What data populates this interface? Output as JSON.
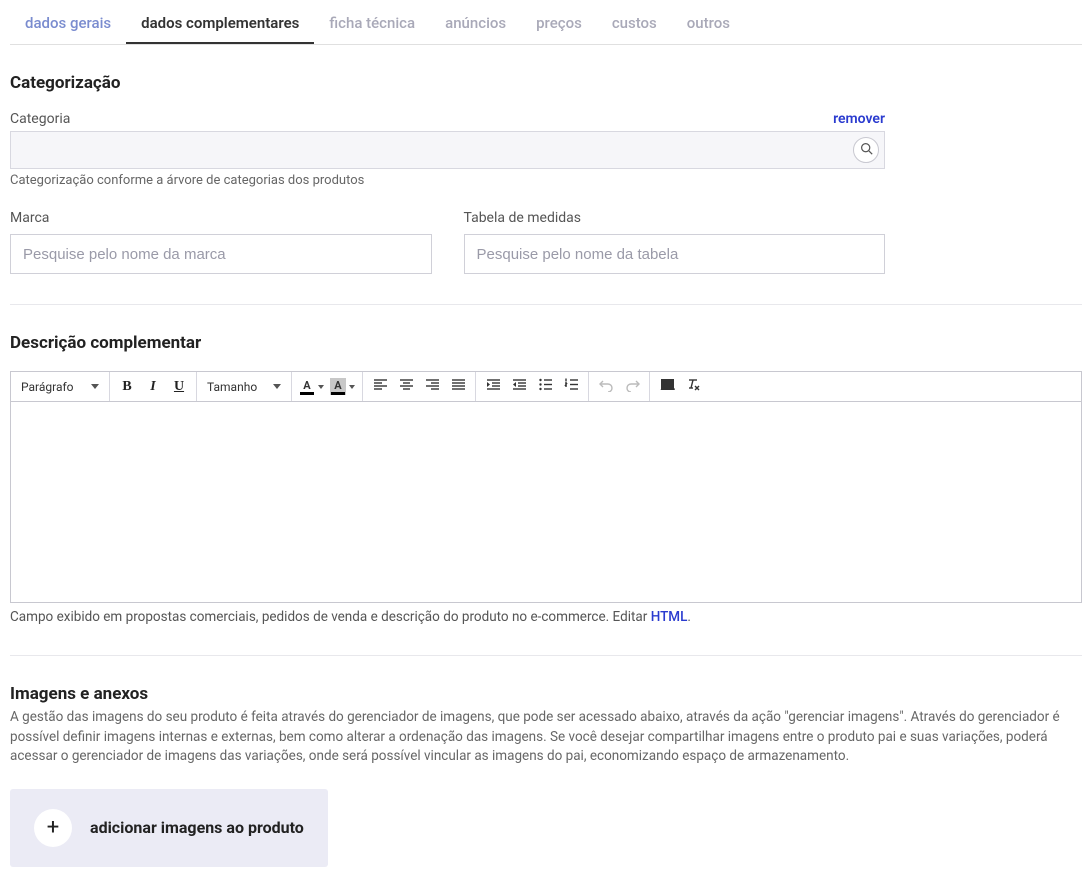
{
  "tabs": [
    {
      "label": "dados gerais"
    },
    {
      "label": "dados complementares"
    },
    {
      "label": "ficha técnica"
    },
    {
      "label": "anúncios"
    },
    {
      "label": "preços"
    },
    {
      "label": "custos"
    },
    {
      "label": "outros"
    }
  ],
  "categorization": {
    "section_title": "Categorização",
    "label": "Categoria",
    "remove": "remover",
    "help": "Categorização conforme a árvore de categorias dos produtos",
    "brand_label": "Marca",
    "brand_placeholder": "Pesquise pelo nome da marca",
    "table_label": "Tabela de medidas",
    "table_placeholder": "Pesquise pelo nome da tabela"
  },
  "description": {
    "section_title": "Descrição complementar",
    "toolbar": {
      "paragraph": "Parágrafo",
      "size": "Tamanho"
    },
    "help_prefix": "Campo exibido em propostas comerciais, pedidos de venda e descrição do produto no e-commerce. Editar ",
    "help_link": "HTML",
    "help_suffix": "."
  },
  "images": {
    "section_title": "Imagens e anexos",
    "description": "A gestão das imagens do seu produto é feita através do gerenciador de imagens, que pode ser acessado abaixo, através da ação \"gerenciar imagens\". Através do gerenciador é possível definir imagens internas e externas, bem como alterar a ordenação das imagens. Se você desejar compartilhar imagens entre o produto pai e suas variações, poderá acessar o gerenciador de imagens das variações, onde será possível vincular as imagens do pai, economizando espaço de armazenamento.",
    "button_label": "adicionar imagens ao produto"
  }
}
